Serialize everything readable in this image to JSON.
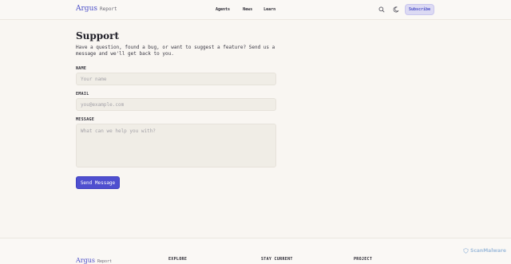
{
  "header": {
    "brand_name": "Argus",
    "brand_sub": "Report",
    "nav": [
      "Agents",
      "News",
      "Learn"
    ],
    "search_icon": "search-icon",
    "theme_icon": "moon-icon",
    "subscribe_label": "Subscribe"
  },
  "main": {
    "title": "Support",
    "intro": "Have a question, found a bug, or want to suggest a feature? Send us a message and we'll get back to you.",
    "name_label": "NAME",
    "name_placeholder": "Your name",
    "email_label": "EMAIL",
    "email_placeholder": "you@example.com",
    "message_label": "MESSAGE",
    "message_placeholder": "What can we help you with?",
    "send_label": "Send Message"
  },
  "footer": {
    "brand_name": "Argus",
    "brand_sub": "Report",
    "headings": [
      "EXPLORE",
      "STAY CURRENT",
      "PROJECT"
    ]
  },
  "watermark": "ScanMalware",
  "colors": {
    "accent": "#4f4fcf",
    "background": "#f9f6f2",
    "subscribe_bg": "#dcdaf3"
  }
}
